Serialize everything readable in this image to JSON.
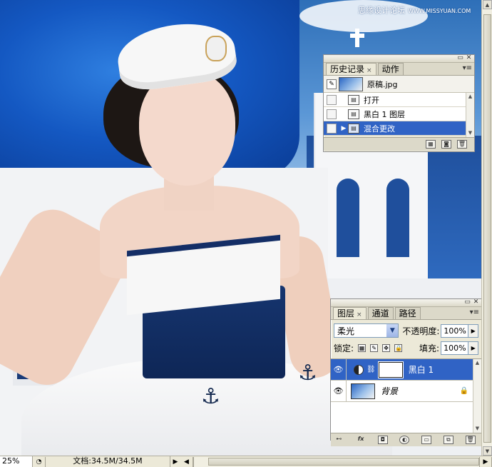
{
  "watermark": {
    "site": "思缘设计论坛",
    "url": "WWW.MISSYUAN.COM"
  },
  "history_panel": {
    "tabs": [
      {
        "label": "历史记录",
        "active": true,
        "closable": true
      },
      {
        "label": "动作",
        "active": false
      }
    ],
    "snapshot_label": "原稿.jpg",
    "states": [
      {
        "label": "打开",
        "active": false
      },
      {
        "label": "黑白 1 图层",
        "active": false
      },
      {
        "label": "混合更改",
        "active": true
      }
    ],
    "bottom_icons": [
      "new-document-icon",
      "snapshot-camera-icon",
      "trash-icon"
    ]
  },
  "layers_panel": {
    "tabs": [
      {
        "label": "图层",
        "active": true,
        "closable": true
      },
      {
        "label": "通道",
        "active": false
      },
      {
        "label": "路径",
        "active": false
      }
    ],
    "blend_mode": "柔光",
    "opacity_label": "不透明度:",
    "opacity_value": "100%",
    "lock_label": "锁定:",
    "fill_label": "填充:",
    "fill_value": "100%",
    "layers": [
      {
        "name": "黑白 1",
        "type": "adjustment",
        "active": true,
        "visible": true
      },
      {
        "name": "背景",
        "type": "background",
        "active": false,
        "visible": true,
        "locked": true
      }
    ],
    "bottom_icons": [
      "link-icon",
      "fx-icon",
      "mask-icon",
      "adjustment-icon",
      "folder-icon",
      "new-layer-icon",
      "trash-icon"
    ],
    "fx_label": "fx"
  },
  "status_bar": {
    "zoom": "25%",
    "doc_info": "文档:34.5M/34.5M"
  },
  "colors": {
    "selection": "#3063c5",
    "panel_bg": "#ece9d8"
  }
}
